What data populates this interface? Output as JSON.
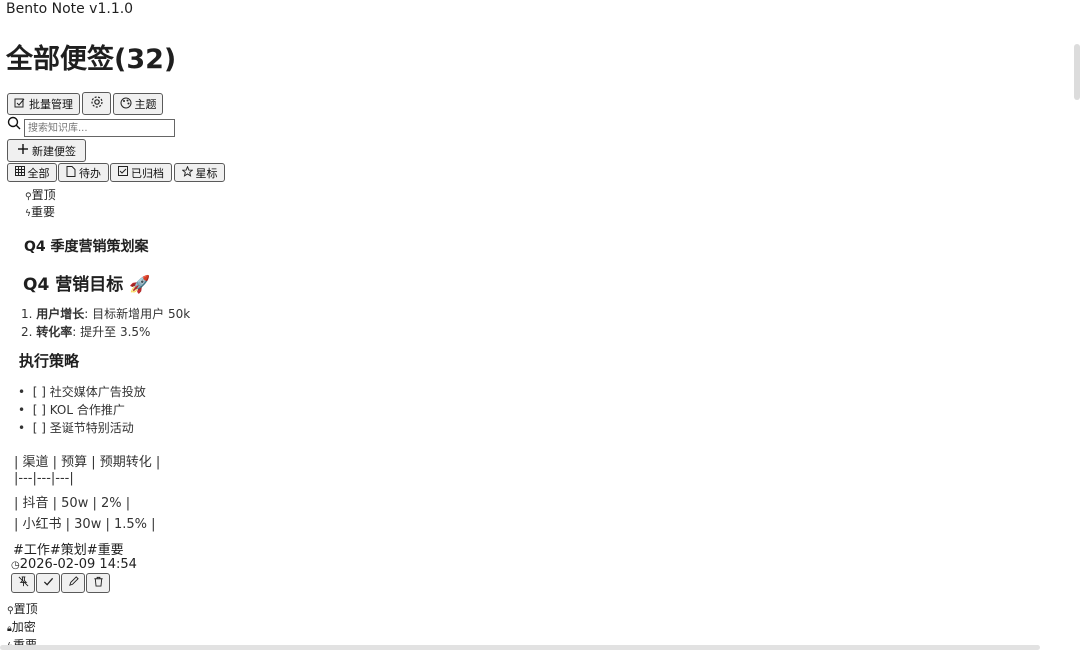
{
  "app": {
    "title": "Bento Note v1.1.0"
  },
  "header": {
    "page_title": "全部便签(32)"
  },
  "toolbar": {
    "batch_label": "批量管理",
    "theme_label": "主题",
    "new_note_label": "新建便签"
  },
  "search": {
    "placeholder": "搜索知识库..."
  },
  "filters": {
    "all": "全部",
    "todo": "待办",
    "archived": "已归档",
    "starred": "星标"
  },
  "note1": {
    "flags": [
      "置顶",
      "重要"
    ],
    "title": "Q4 季度营销策划案",
    "heading1": "Q4 营销目标 🚀",
    "goals": [
      {
        "num": "1.",
        "bold": "用户增长",
        "text": ": 目标新增用户 50k"
      },
      {
        "num": "2.",
        "bold": "转化率",
        "text": ": 提升至 3.5%"
      }
    ],
    "heading2": "执行策略",
    "tasks": [
      "[ ] 社交媒体广告投放",
      "[ ] KOL 合作推广",
      "[ ] 圣诞节特别活动"
    ],
    "table_lines": [
      "| 渠道 | 预算 | 预期转化 |",
      "|---|---|---|",
      "| 抖音 | 50w | 2% |",
      "| 小红书 | 30w | 1.5% |"
    ],
    "tags": "#工作#策划#重要",
    "timestamp": "2026-02-09 14:54"
  },
  "note2": {
    "flags": [
      "置顶",
      "加密",
      "重要"
    ]
  }
}
